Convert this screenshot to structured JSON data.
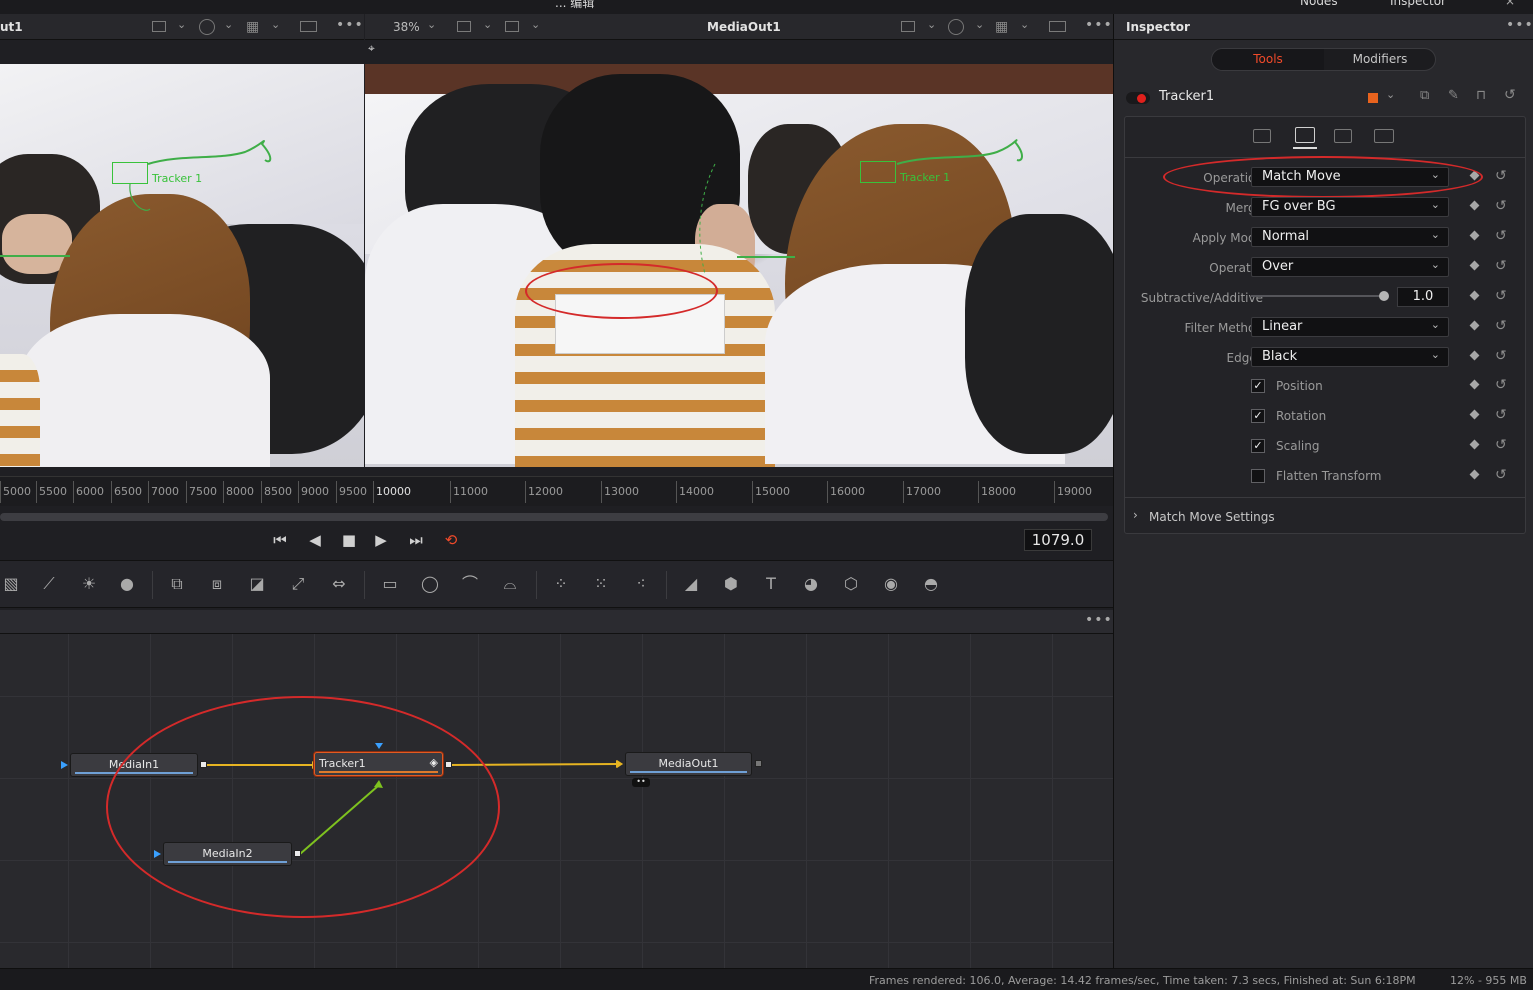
{
  "top_strip": {
    "left_text": "... 编辑",
    "right_text_a": "Nodes",
    "right_text_b": "Inspector"
  },
  "viewer_left": {
    "title": "ut1"
  },
  "viewer_right": {
    "zoom": "38%",
    "title": "MediaOut1"
  },
  "tracker_label": "Tracker 1",
  "ruler": {
    "ticks_left": [
      "5000",
      "5500",
      "6000",
      "6500",
      "7000",
      "7500",
      "8000",
      "8500",
      "9000",
      "9500",
      "10000"
    ],
    "ticks_right": [
      "11000",
      "12000",
      "13000",
      "14000",
      "15000",
      "16000",
      "17000",
      "18000",
      "19000"
    ]
  },
  "transport": {
    "timecode": "1079.0"
  },
  "nodes": {
    "media_in_1": "MediaIn1",
    "tracker_1": "Tracker1",
    "media_out_1": "MediaOut1",
    "media_in_2": "MediaIn2"
  },
  "status": {
    "frames": "Frames rendered: 106.0,  Average: 14.42 frames/sec,  Time taken: 7.3 secs,  Finished at: Sun 6:18PM",
    "memory": "12% - 955 MB"
  },
  "inspector": {
    "title": "Inspector",
    "tabs": {
      "tools": "Tools",
      "modifiers": "Modifiers"
    },
    "tool_name": "Tracker1",
    "accent": "#f04a2a",
    "fields": {
      "operation": {
        "label": "Operation",
        "value": "Match Move"
      },
      "merge": {
        "label": "Merge",
        "value": "FG over BG"
      },
      "apply_mode": {
        "label": "Apply Mode",
        "value": "Normal"
      },
      "operator": {
        "label": "Operator",
        "value": "Over"
      },
      "sub_add": {
        "label": "Subtractive/Additive",
        "value": "1.0",
        "slider_fraction": 1.0
      },
      "filter": {
        "label": "Filter Method",
        "value": "Linear"
      },
      "edges": {
        "label": "Edges",
        "value": "Black"
      }
    },
    "checkboxes": [
      {
        "label": "Position",
        "checked": true
      },
      {
        "label": "Rotation",
        "checked": true
      },
      {
        "label": "Scaling",
        "checked": true
      },
      {
        "label": "Flatten Transform",
        "checked": false
      }
    ],
    "section": "Match Move Settings"
  }
}
